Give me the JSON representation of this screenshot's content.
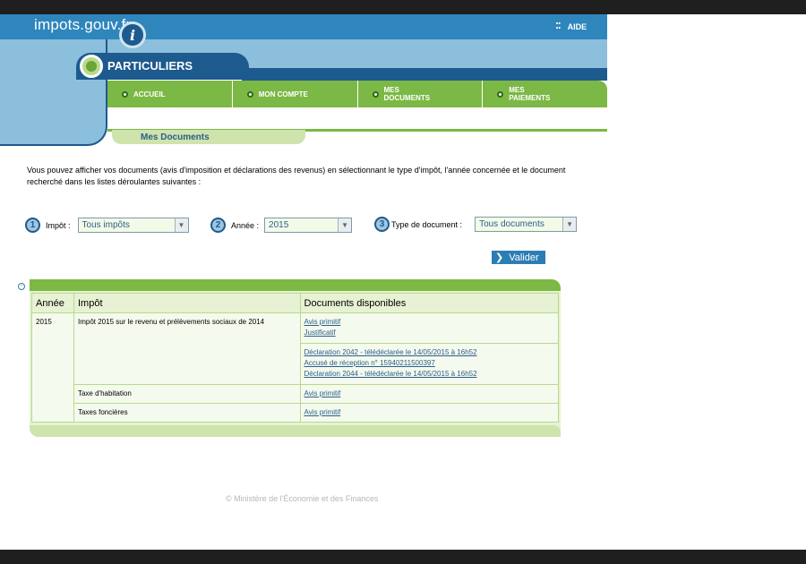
{
  "header": {
    "logo_text": "impots.gouv.fr",
    "logo_mark": "i",
    "aide": "AIDE",
    "section": "PARTICULIERS"
  },
  "nav": {
    "items": [
      {
        "label": "ACCUEIL"
      },
      {
        "label": "MON COMPTE"
      },
      {
        "label": "MES DOCUMENTS"
      },
      {
        "label": "MES PAIEMENTS"
      }
    ]
  },
  "subtab": "Mes Documents",
  "intro": "Vous pouvez afficher vos documents (avis d'imposition et déclarations des revenus) en sélectionnant le type d'impôt, l'année concernée et le document recherché dans les listes déroulantes suivantes :",
  "filters": {
    "impot": {
      "num": "1",
      "label": "Impôt :",
      "value": "Tous impôts"
    },
    "annee": {
      "num": "2",
      "label": "Année :",
      "value": "2015"
    },
    "type": {
      "num": "3",
      "label": "Type de document :",
      "value": "Tous documents"
    }
  },
  "valider": "Valider",
  "table": {
    "headers": [
      "Année",
      "Impôt",
      "Documents disponibles"
    ],
    "rows": [
      {
        "annee": "2015",
        "impot": "Impôt 2015 sur le revenu et prélèvements sociaux de 2014",
        "docs1": [
          "Avis primitif",
          "Justificatif"
        ],
        "docs2": [
          "Déclaration 2042 - télédéclarée le 14/05/2015 à 16h52",
          "Accusé de réception n° 15940211500397",
          "Déclaration 2044 - télédéclarée le 14/05/2015 à 16h52"
        ]
      },
      {
        "impot": "Taxe d'habitation",
        "docs": [
          "Avis primitif"
        ]
      },
      {
        "impot": "Taxes foncières",
        "docs": [
          "Avis primitif"
        ]
      }
    ]
  },
  "footer": "© Ministère de l'Économie et des Finances",
  "colors": {
    "accent_green": "#7cb845",
    "header_blue": "#2f86bd",
    "dark_blue": "#1d5a8e",
    "link": "#2a5f8b"
  }
}
